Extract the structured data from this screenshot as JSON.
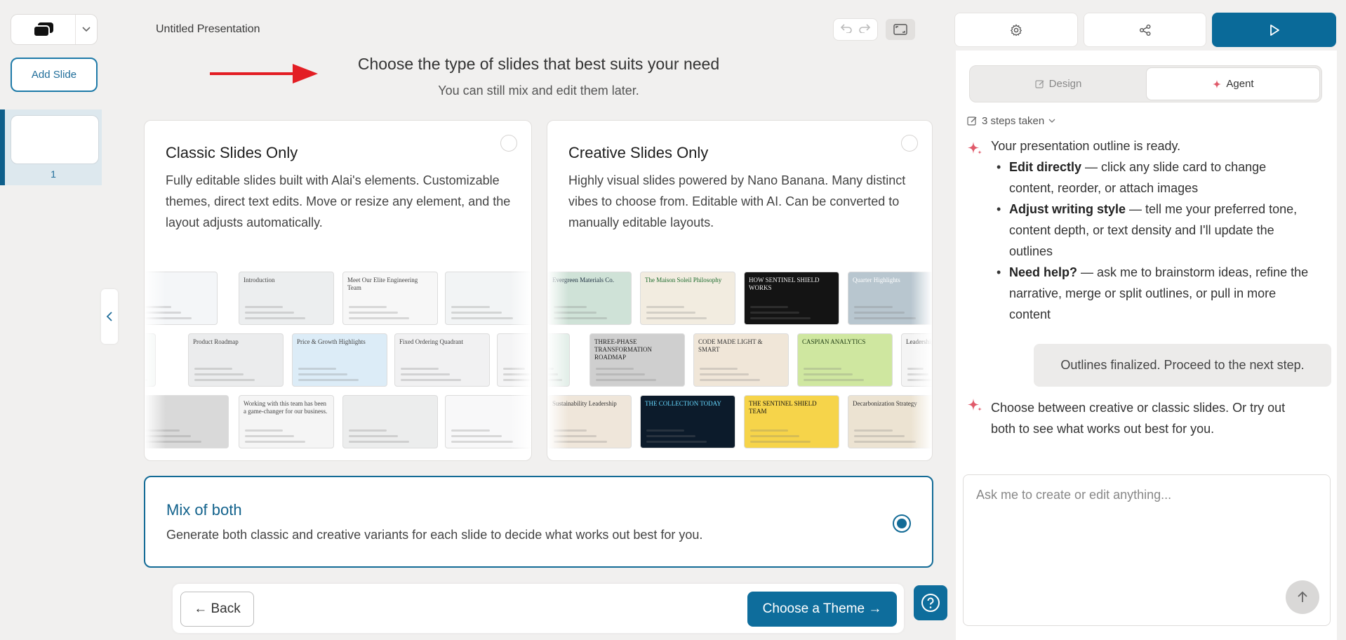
{
  "sidebar": {
    "add_slide_label": "Add Slide",
    "slide_number": "1"
  },
  "toolbar": {
    "presentation_title": "Untitled Presentation"
  },
  "main": {
    "heading": "Choose the type of slides that best suits your need",
    "subheading": "You can still mix and edit them later.",
    "options": {
      "classic": {
        "title": "Classic Slides Only",
        "description": "Fully editable slides built with Alai's elements. Customizable themes, direct text edits. Move or resize any element, and the layout adjusts automatically.",
        "selected": false
      },
      "creative": {
        "title": "Creative Slides Only",
        "description": "Highly visual slides powered by Nano Banana. Many distinct vibes to choose from. Editable with AI. Can be converted to manually editable layouts.",
        "selected": false
      },
      "mix": {
        "title": "Mix of both",
        "description": "Generate both classic and creative variants for each slide to decide what works out best for you.",
        "selected": true
      }
    },
    "classic_thumbs": [
      {
        "label": "",
        "bg": "#f4f6f8"
      },
      {
        "label": "Introduction",
        "bg": "#eceeef"
      },
      {
        "label": "Meet Our Elite Engineering Team",
        "bg": "#f7f7f7"
      },
      {
        "label": "",
        "bg": "#f2f4f5"
      },
      {
        "label": "",
        "bg": "#eef4f1"
      },
      {
        "label": "Product Roadmap",
        "bg": "#ebeced"
      },
      {
        "label": "Price & Growth Highlights",
        "bg": "#dcecf7"
      },
      {
        "label": "Fixed Ordering Quadrant",
        "bg": "#f1f1f2"
      },
      {
        "label": "",
        "bg": "#f4f4f5"
      },
      {
        "label": "",
        "bg": "#d9d9d9"
      },
      {
        "label": "Working with this team has been a game-changer for our business.",
        "bg": "#f5f5f5"
      },
      {
        "label": "",
        "bg": "#eceded"
      },
      {
        "label": "",
        "bg": "#f8f8f9"
      }
    ],
    "creative_thumbs": [
      {
        "label": "Evergreen Materials Co.",
        "bg": "#cfe2d7",
        "color": "#234"
      },
      {
        "label": "The Maison Soleil Philosophy",
        "bg": "#f2ece0",
        "color": "#1c6b2c"
      },
      {
        "label": "HOW SENTINEL SHIELD WORKS",
        "bg": "#141414",
        "color": "#eee"
      },
      {
        "label": "Quarter Highlights",
        "bg": "#b8c6cf",
        "color": "#fff"
      },
      {
        "label": "",
        "bg": "#e2eee8",
        "color": "#333"
      },
      {
        "label": "THREE-PHASE TRANSFORMATION ROADMAP",
        "bg": "#cfcfcf",
        "color": "#222"
      },
      {
        "label": "CODE MADE LIGHT & SMART",
        "bg": "#f0e6d8",
        "color": "#333"
      },
      {
        "label": "CASPIAN ANALYTICS",
        "bg": "#cfe7a0",
        "color": "#1d3a12"
      },
      {
        "label": "Leadership",
        "bg": "#f4f4f4",
        "color": "#333"
      },
      {
        "label": "Sustainability Leadership",
        "bg": "#efe6da",
        "color": "#333"
      },
      {
        "label": "THE COLLECTION TODAY",
        "bg": "#0c1b2b",
        "color": "#66d9ff"
      },
      {
        "label": "THE SENTINEL SHIELD TEAM",
        "bg": "#f6d44a",
        "color": "#111"
      },
      {
        "label": "Decarbonization Strategy",
        "bg": "#ece3d2",
        "color": "#333"
      }
    ]
  },
  "footer": {
    "back_label": "← Back",
    "theme_label": "Choose a Theme →"
  },
  "panel": {
    "design_tab": "Design",
    "agent_tab": "Agent",
    "steps_label": "3 steps taken",
    "agent_msg1_intro": "Your presentation outline is ready.",
    "bullets": [
      {
        "bold": "Edit directly",
        "text": " — click any slide card to change content, reorder, or attach images"
      },
      {
        "bold": "Adjust writing style",
        "text": " — tell me your preferred tone, content depth, or text density and I'll update the outlines"
      },
      {
        "bold": "Need help?",
        "text": " — ask me to brainstorm ideas, refine the narrative, merge or split outlines, or pull in more content"
      }
    ],
    "user_msg": "Outlines finalized. Proceed to the next step.",
    "agent_msg2": "Choose between creative or classic slides. Or try out both to see what works out best for you.",
    "input_placeholder": "Ask me to create or edit anything...",
    "input_value": ""
  },
  "colors": {
    "accent": "#0e6d9c",
    "arrow": "#e31e24",
    "sparkle": "#e05a6a"
  }
}
